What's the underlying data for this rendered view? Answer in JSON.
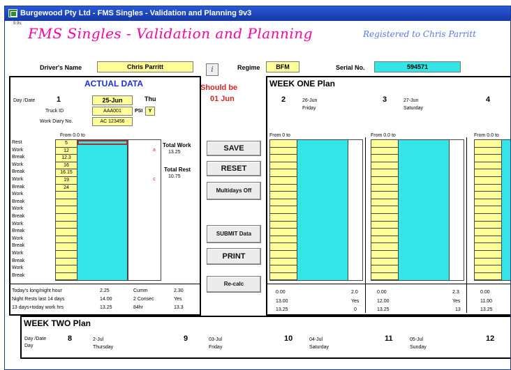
{
  "window": {
    "title": "Burgewood Pty Ltd - FMS Singles - Validation and Planning 9v3",
    "version": "9.9v."
  },
  "app": {
    "heading": "FMS Singles - Validation and Planning",
    "registered_to": "Registered to Chris Parritt"
  },
  "driver": {
    "name_label": "Driver's Name",
    "name": "Chris Parritt",
    "info_label": "i",
    "regime_label": "Regime",
    "regime": "BFM",
    "serial_label": "Serial No.",
    "serial": "594571"
  },
  "actual": {
    "title": "ACTUAL DATA",
    "day_date_label": "Day /Date",
    "day_num": "1",
    "date": "25-Jun",
    "weekday": "Thu",
    "truck_id_label": "Truck ID",
    "truck_id": "AAA001",
    "psi_label": "PSI",
    "psi": "Y",
    "diary_label": "Work Diary No.",
    "diary": "AC 123456",
    "from_label": "From 0.0 to",
    "rows": [
      {
        "label": "Rest",
        "value": "5",
        "flag": ""
      },
      {
        "label": "Work",
        "value": "12",
        "flag": "a"
      },
      {
        "label": "Break",
        "value": "12.3",
        "flag": ""
      },
      {
        "label": "Work",
        "value": "16",
        "flag": ""
      },
      {
        "label": "Break",
        "value": "16.15",
        "flag": ""
      },
      {
        "label": "Work",
        "value": "19",
        "flag": "c"
      },
      {
        "label": "Break",
        "value": "24",
        "flag": ""
      },
      {
        "label": "Work",
        "value": "",
        "flag": ""
      },
      {
        "label": "Break",
        "value": "",
        "flag": ""
      },
      {
        "label": "Work",
        "value": "",
        "flag": ""
      },
      {
        "label": "Break",
        "value": "",
        "flag": ""
      },
      {
        "label": "Work",
        "value": "",
        "flag": ""
      },
      {
        "label": "Break",
        "value": "",
        "flag": ""
      },
      {
        "label": "Work",
        "value": "",
        "flag": ""
      },
      {
        "label": "Break",
        "value": "",
        "flag": ""
      },
      {
        "label": "Work",
        "value": "",
        "flag": ""
      },
      {
        "label": "Break",
        "value": "",
        "flag": ""
      },
      {
        "label": "Work",
        "value": "",
        "flag": ""
      },
      {
        "label": "Break",
        "value": "",
        "flag": ""
      }
    ],
    "total_work_label": "Total Work",
    "total_work": "13.25",
    "total_rest_label": "Total Rest",
    "total_rest": "10.75",
    "stats": [
      {
        "label": "Today's long/night hour",
        "v1": "2.25",
        "label2": "Cumm",
        "v2": "2.30"
      },
      {
        "label": "Night Rests last 14 days",
        "v1": "14.00",
        "label2": "2 Consec",
        "v2": "Yes"
      },
      {
        "label": "13 days+today work hrs",
        "v1": "13.25",
        "label2": "84hr",
        "v2": "13.3"
      }
    ]
  },
  "should_be": {
    "label": "Should be",
    "value": "01 Jun"
  },
  "buttons": {
    "save": "SAVE",
    "reset": "RESET",
    "multidays": "Multidays Off",
    "submit": "SUBMIT Data",
    "print": "PRINT",
    "recalc": "Re-calc"
  },
  "week_one": {
    "title": "WEEK ONE Plan",
    "days": [
      {
        "num": "2",
        "date": "26-Jun",
        "weekday": "Friday",
        "from": "From 0 to",
        "s1": "0.00",
        "s1b": "2.0",
        "s2": "13.00",
        "s2b": "Yes",
        "s3": "13.25",
        "s3b": "0"
      },
      {
        "num": "3",
        "date": "27-Jun",
        "weekday": "Saturday",
        "from": "From 0.0 to",
        "s1": "0.00",
        "s1b": "2.3",
        "s2": "12.00",
        "s2b": "Yes",
        "s3": "13.25",
        "s3b": "13"
      },
      {
        "num": "4",
        "date": "",
        "weekday": "",
        "from": "From 0.0 to",
        "s1": "0.00",
        "s1b": "",
        "s2": "11.00",
        "s2b": "",
        "s3": "13.25",
        "s3b": ""
      }
    ]
  },
  "week_two": {
    "title": "WEEK TWO Plan",
    "day_date_label": "Day /Date",
    "day_label": "Day",
    "days": [
      {
        "num": "8",
        "date": "2-Jul",
        "weekday": "Thursday"
      },
      {
        "num": "9",
        "date": "03-Jul",
        "weekday": "Friday"
      },
      {
        "num": "10",
        "date": "04-Jul",
        "weekday": "Saturday"
      },
      {
        "num": "11",
        "date": "05-Jul",
        "weekday": "Sunday"
      },
      {
        "num": "12",
        "date": "",
        "weekday": ""
      }
    ]
  },
  "colors": {
    "title_bar": "#1c44b8",
    "heading": "#ff00a8",
    "yellow": "#ffff99",
    "cyan": "#33e5e6",
    "red": "#d42424",
    "blue": "#1c2fd0"
  }
}
